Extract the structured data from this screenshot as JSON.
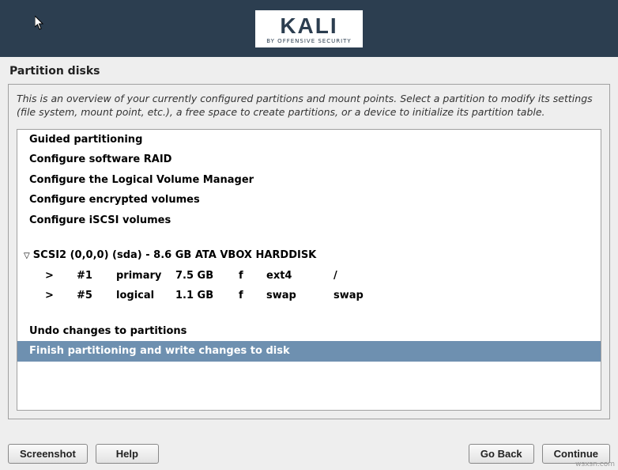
{
  "logo": {
    "brand": "KALI",
    "tagline": "BY OFFENSIVE SECURITY"
  },
  "page_title": "Partition disks",
  "instructions": "This is an overview of your currently configured partitions and mount points. Select a partition to modify its settings (file system, mount point, etc.), a free space to create partitions, or a device to initialize its partition table.",
  "menu_top": [
    "Guided partitioning",
    "Configure software RAID",
    "Configure the Logical Volume Manager",
    "Configure encrypted volumes",
    "Configure iSCSI volumes"
  ],
  "disk": {
    "label": "SCSI2 (0,0,0) (sda) - 8.6 GB ATA VBOX HARDDISK",
    "partitions": [
      {
        "arrow": ">",
        "num": "#1",
        "type": "primary",
        "size": "7.5 GB",
        "flag": "f",
        "fs": "ext4",
        "mount": "/"
      },
      {
        "arrow": ">",
        "num": "#5",
        "type": "logical",
        "size": "1.1 GB",
        "flag": "f",
        "fs": "swap",
        "mount": "swap"
      }
    ]
  },
  "menu_bottom": [
    {
      "label": "Undo changes to partitions",
      "selected": false
    },
    {
      "label": "Finish partitioning and write changes to disk",
      "selected": true
    }
  ],
  "buttons": {
    "screenshot": "Screenshot",
    "help": "Help",
    "go_back": "Go Back",
    "continue": "Continue"
  },
  "watermark": "wsxsn.com"
}
